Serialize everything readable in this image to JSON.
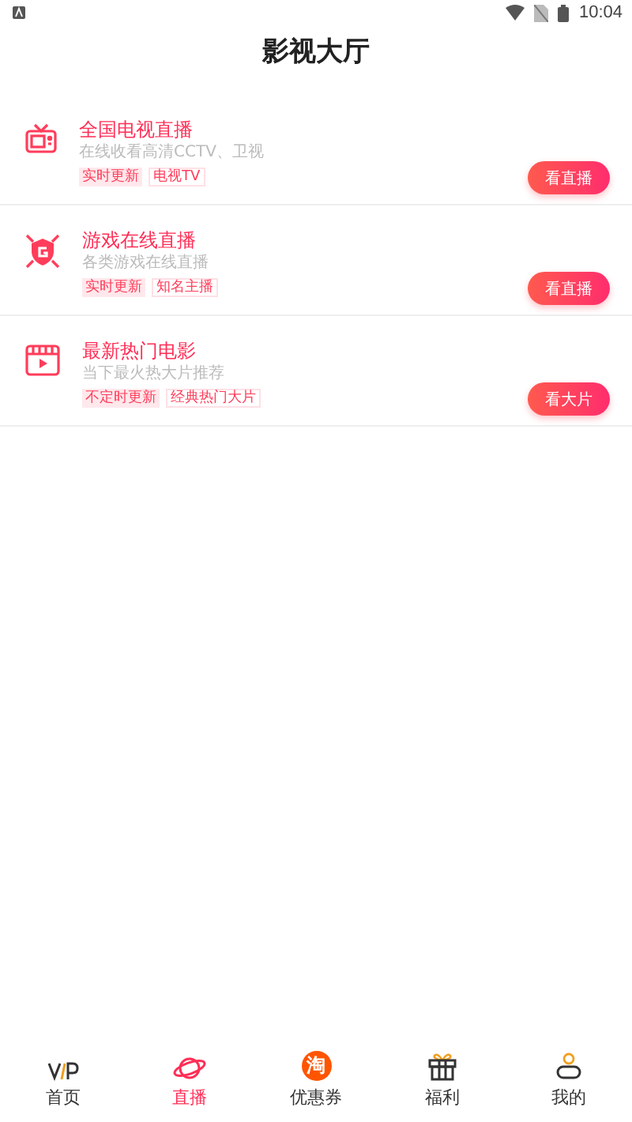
{
  "status_bar": {
    "time": "10:04"
  },
  "title": "影视大厅",
  "items": [
    {
      "kind": "tv",
      "title": "全国电视直播",
      "subtitle": "在线收看高清CCTV、卫视",
      "tags": [
        {
          "label": "实时更新",
          "kind": "filled"
        },
        {
          "label": "电视TV",
          "kind": "outline"
        }
      ],
      "button": "看直播"
    },
    {
      "kind": "game",
      "title": "游戏在线直播",
      "subtitle": "各类游戏在线直播",
      "tags": [
        {
          "label": "实时更新",
          "kind": "filled"
        },
        {
          "label": "知名主播",
          "kind": "outline"
        }
      ],
      "button": "看直播"
    },
    {
      "kind": "movie",
      "title": "最新热门电影",
      "subtitle": "当下最火热大片推荐",
      "tags": [
        {
          "label": "不定时更新",
          "kind": "filled"
        },
        {
          "label": "经典热门大片",
          "kind": "outline"
        }
      ],
      "button": "看大片"
    }
  ],
  "tabs": [
    {
      "kind": "home",
      "label": "首页",
      "selected": false
    },
    {
      "kind": "live",
      "label": "直播",
      "selected": true
    },
    {
      "kind": "coupon",
      "icon_text": "淘",
      "label": "优惠券",
      "selected": false
    },
    {
      "kind": "welfare",
      "label": "福利",
      "selected": false
    },
    {
      "kind": "mine",
      "label": "我的",
      "selected": false
    }
  ]
}
